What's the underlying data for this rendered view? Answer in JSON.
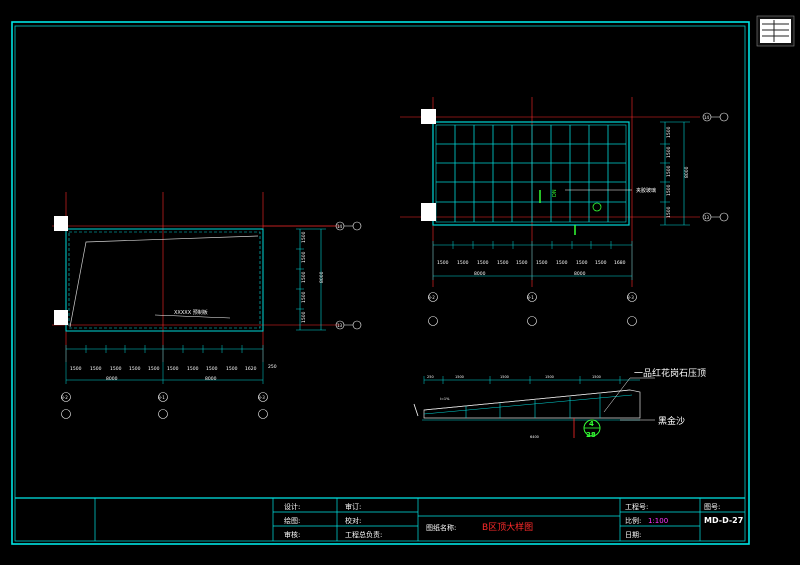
{
  "drawing": {
    "title_block": {
      "design_label": "设计:",
      "draw_label": "绘图:",
      "review_label": "审核:",
      "approve_label": "审订:",
      "check_label": "校对:",
      "chief_label": "工程总负责:",
      "drawing_name_label": "图纸名称:",
      "drawing_name": "B区顶大样图",
      "project_no_label": "工程号:",
      "scale_label": "比例:",
      "scale_value": "1:100",
      "date_label": "日期:",
      "sheet_no_label": "图号:",
      "sheet_no": "MD-D-27"
    },
    "left_plan": {
      "note": "XXXXX 预制板",
      "right_dims": [
        "1500",
        "1500",
        "1500",
        "1500",
        "1500"
      ],
      "right_total": "8000",
      "bottom_dims": [
        "1500",
        "1500",
        "1500",
        "1500",
        "1500",
        "1500",
        "1500",
        "1500",
        "1500",
        "1620"
      ],
      "bottom_totals": [
        "8000",
        "8000"
      ],
      "side_dim": "250"
    },
    "right_plan": {
      "note": "夹胶玻璃",
      "right_dims": [
        "1500",
        "1500",
        "1500",
        "1500",
        "1500"
      ],
      "right_total": "8000",
      "bottom_dims": [
        "1500",
        "1500",
        "1500",
        "1500",
        "1500",
        "1500",
        "1500",
        "1500",
        "1500",
        "1680"
      ],
      "bottom_totals": [
        "8000",
        "8000"
      ]
    },
    "section": {
      "label_granite": "一品红花岗石压顶",
      "label_sand": "黑金沙",
      "slope": "i=1%",
      "detail_top": "4",
      "detail_bottom": "28",
      "top_dims": [
        "250",
        "1500",
        "1500",
        "1500",
        "1500"
      ],
      "bottom_dim": "6400"
    },
    "axis_labels": {
      "h1": "14",
      "h2": "13",
      "h3": "14",
      "h4": "13",
      "b1": "B-2",
      "b2": "B-1",
      "b3": "B-3",
      "b4": "B-2",
      "b5": "B-1",
      "b6": "B-3",
      "rB1": "14",
      "rB2": "13",
      "lA1": "14",
      "lA2": "13"
    },
    "colors": {
      "frame": "#00e5e5",
      "grid": "#00d7d7",
      "red": "#ff2a2a",
      "green": "#33ff33",
      "white": "#ffffff",
      "magenta": "#ff33ff",
      "yellow": "#ffff00"
    }
  }
}
